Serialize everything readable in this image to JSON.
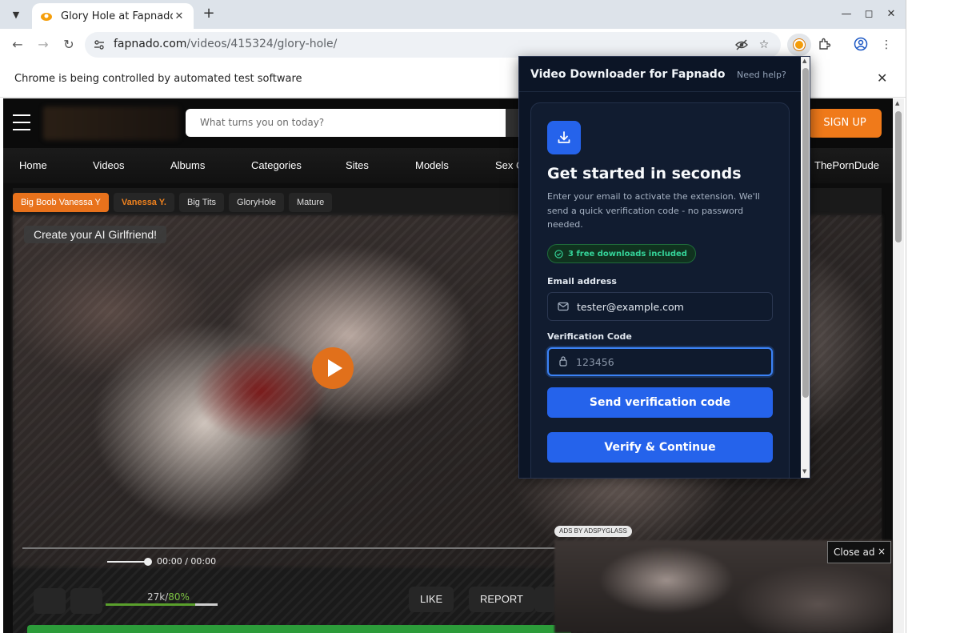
{
  "browser": {
    "tab_title": "Glory Hole at Fapnado",
    "new_tab": "+",
    "url_host": "fapnado.com",
    "url_path": "/videos/415324/glory-hole/",
    "infobar_text": "Chrome is being controlled by automated test software"
  },
  "site": {
    "search_placeholder": "What turns you on today?",
    "signup_label": "SIGN UP",
    "nav": [
      "Home",
      "Videos",
      "Albums",
      "Categories",
      "Sites",
      "Models",
      "Sex C",
      "ThePornDude"
    ],
    "tags": [
      "Big Boob Vanessa Y",
      "Vanessa Y.",
      "Big Tits",
      "GloryHole",
      "Mature"
    ],
    "ai_banner": "Create your AI Girlfriend!",
    "time_display": "00:00 / 00:00",
    "rating_count": "27k/",
    "rating_pct": "80%",
    "rating_fraction": 0.8,
    "like_label": "LIKE",
    "report_label": "REPORT",
    "ad_label": "ADS BY ADSPYGLASS",
    "close_ad_label": "Close ad",
    "close_ad_x": "×"
  },
  "extension": {
    "title": "Video Downloader for Fapnado",
    "help": "Need help?",
    "heading": "Get started in seconds",
    "description": "Enter your email to activate the extension. We'll send a quick verification code - no password needed.",
    "badge": "3 free downloads included",
    "email_label": "Email address",
    "email_value": "tester@example.com",
    "code_label": "Verification Code",
    "code_placeholder": "123456",
    "send_button": "Send verification code",
    "verify_button": "Verify & Continue"
  },
  "colors": {
    "brand_orange": "#e8721c",
    "popup_bg": "#0c1526",
    "primary_blue": "#2563eb",
    "badge_green": "#34d399"
  }
}
